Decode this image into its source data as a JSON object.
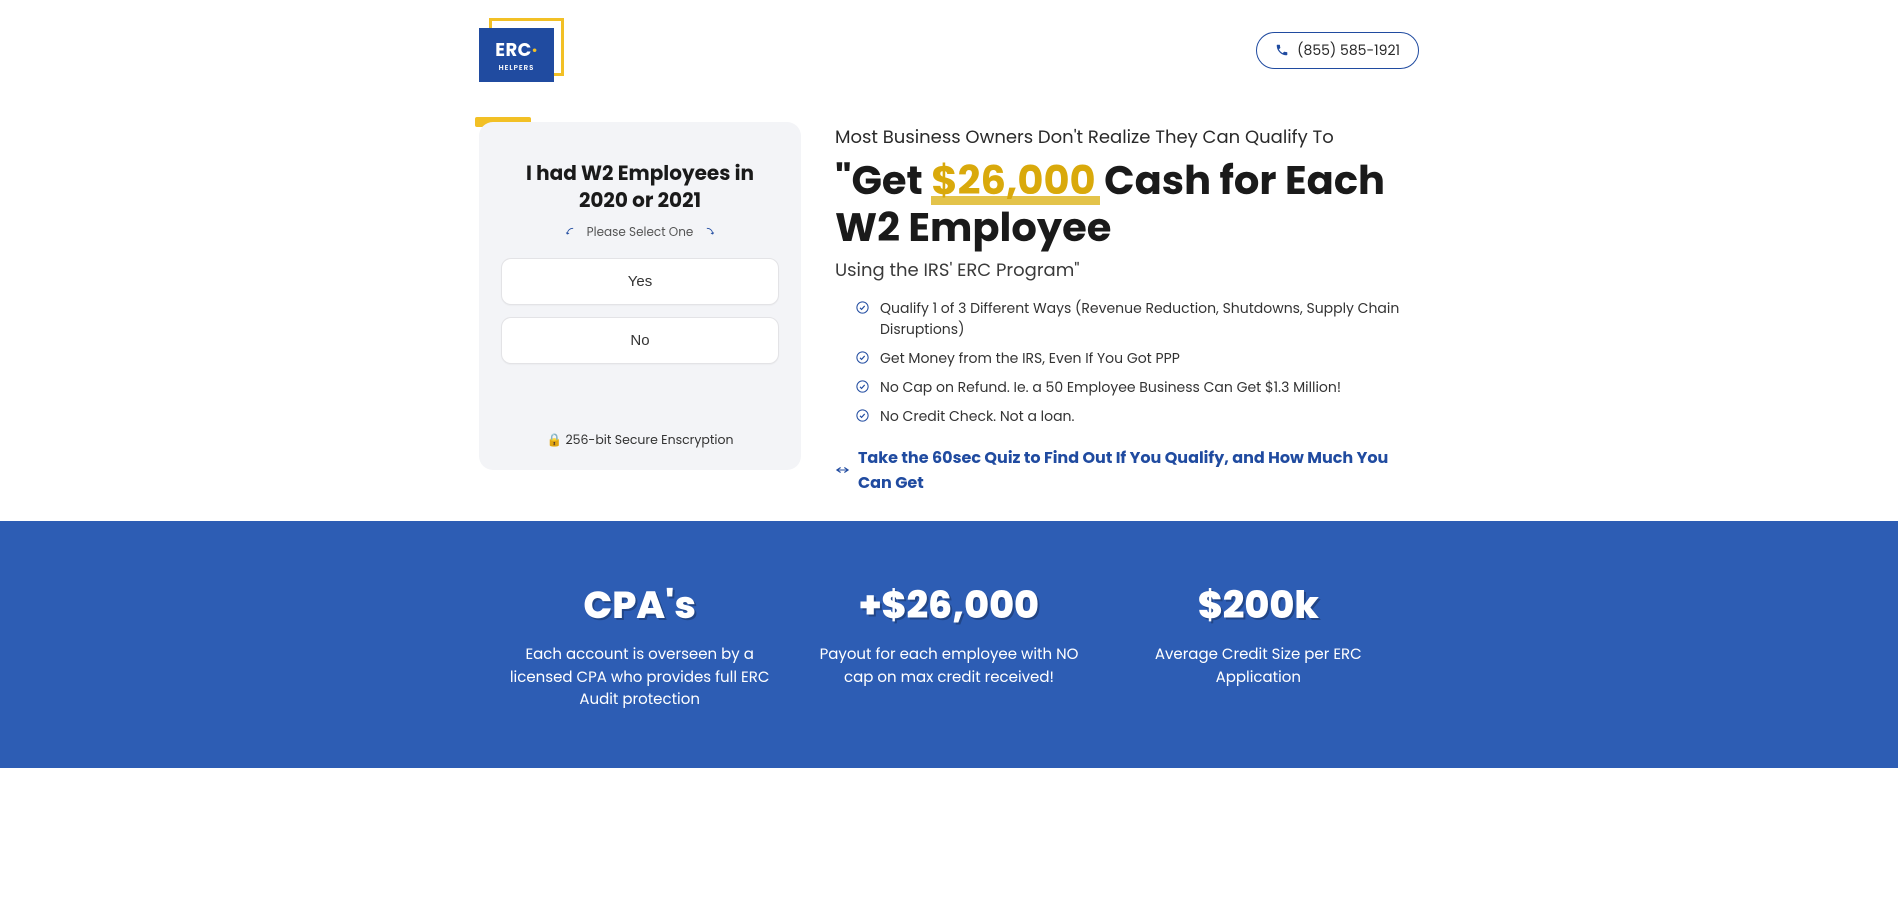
{
  "header": {
    "logo": {
      "line1": "ERC",
      "line2": "HELPERS"
    },
    "phone": "(855) 585-1921"
  },
  "quiz": {
    "title": "I had W2 Employees in 2020 or 2021",
    "instruction": "Please Select One",
    "options": [
      "Yes",
      "No"
    ],
    "encryption": "256-bit Secure Enscryption",
    "lock_icon": "🔒"
  },
  "hero": {
    "preline": "Most Business Owners Don't Realize They Can Qualify To",
    "headline_prefix": "\"Get ",
    "headline_gold": "$26,000",
    "headline_suffix": " Cash for Each W2 Employee",
    "subline": "Using the IRS' ERC Program\"",
    "bullets": [
      "Qualify 1 of 3 Different Ways (Revenue Reduction, Shutdowns, Supply Chain Disruptions)",
      "Get Money from the IRS, Even If You Got PPP",
      "No Cap on Refund. Ie. a 50 Employee Business Can Get $1.3 Million!",
      "No Credit Check. Not a loan."
    ],
    "cta": "Take the 60sec Quiz to Find Out If You Qualify, and How Much You Can Get"
  },
  "metrics": [
    {
      "value": "CPA's",
      "desc": "Each account is overseen by a licensed CPA who provides full ERC Audit protection"
    },
    {
      "value": "+$26,000",
      "desc": "Payout for each employee with NO cap on max credit received!"
    },
    {
      "value": "$200k",
      "desc": "Average Credit Size per ERC Application"
    }
  ]
}
